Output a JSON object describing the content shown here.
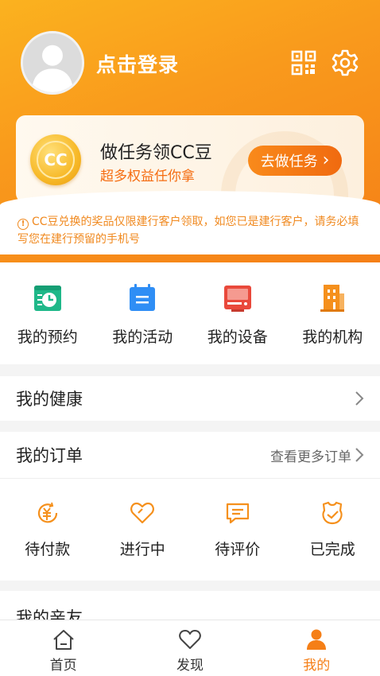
{
  "profile": {
    "login_text": "点击登录"
  },
  "task_card": {
    "coin_text": "CC",
    "title": "做任务领CC豆",
    "subtitle": "超多权益任你拿",
    "button_label": "去做任务",
    "button_arrow": "›"
  },
  "notice": {
    "icon": "!",
    "text": "CC豆兑换的奖品仅限建行客户领取，如您已是建行客户，请务必填写您在建行预留的手机号"
  },
  "quick_links": [
    {
      "label": "我的预约",
      "icon": "appointment-icon",
      "color": "#1fb889"
    },
    {
      "label": "我的活动",
      "icon": "activity-icon",
      "color": "#2f8ef5"
    },
    {
      "label": "我的设备",
      "icon": "device-icon",
      "color": "#e9493b"
    },
    {
      "label": "我的机构",
      "icon": "institution-icon",
      "color": "#f5901c"
    }
  ],
  "health": {
    "title": "我的健康"
  },
  "orders": {
    "title": "我的订单",
    "more_label": "查看更多订单",
    "items": [
      {
        "label": "待付款",
        "icon": "pending-payment-icon"
      },
      {
        "label": "进行中",
        "icon": "in-progress-icon"
      },
      {
        "label": "待评价",
        "icon": "to-review-icon"
      },
      {
        "label": "已完成",
        "icon": "completed-icon"
      }
    ],
    "accent": "#f5901c"
  },
  "relatives": {
    "title": "我的亲友"
  },
  "tabbar": {
    "items": [
      {
        "label": "首页",
        "icon": "home-icon"
      },
      {
        "label": "发现",
        "icon": "heart-icon"
      },
      {
        "label": "我的",
        "icon": "person-icon",
        "active": true
      }
    ],
    "active_color": "#f57f17"
  }
}
